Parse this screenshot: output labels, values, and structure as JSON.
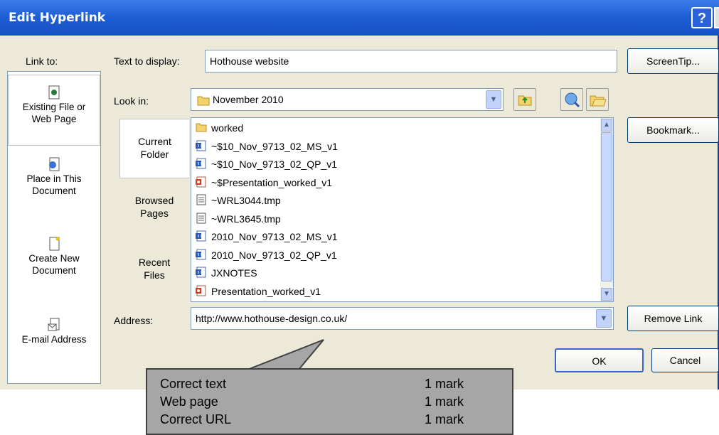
{
  "window": {
    "title": "Edit Hyperlink",
    "help_label": "?"
  },
  "link_to": {
    "label": "Link to:",
    "items": [
      {
        "label_line1": "Existing File or",
        "label_line2": "Web Page"
      },
      {
        "label_line1": "Place in This",
        "label_line2": "Document"
      },
      {
        "label_line1": "Create New",
        "label_line2": "Document"
      },
      {
        "label_line1": "E-mail Address",
        "label_line2": ""
      }
    ]
  },
  "text_to_display": {
    "label": "Text to display:",
    "value": "Hothouse website"
  },
  "screentip_button": "ScreenTip...",
  "look_in": {
    "label": "Look in:",
    "value": "November 2010"
  },
  "tabs": [
    {
      "line1": "Current",
      "line2": "Folder"
    },
    {
      "line1": "Browsed",
      "line2": "Pages"
    },
    {
      "line1": "Recent",
      "line2": "Files"
    }
  ],
  "files": [
    {
      "name": "worked",
      "icon": "folder-icon"
    },
    {
      "name": "~$10_Nov_9713_02_MS_v1",
      "icon": "word-doc-icon"
    },
    {
      "name": "~$10_Nov_9713_02_QP_v1",
      "icon": "word-doc-icon"
    },
    {
      "name": "~$Presentation_worked_v1",
      "icon": "powerpoint-icon"
    },
    {
      "name": "~WRL3044.tmp",
      "icon": "tmp-file-icon"
    },
    {
      "name": "~WRL3645.tmp",
      "icon": "tmp-file-icon"
    },
    {
      "name": "2010_Nov_9713_02_MS_v1",
      "icon": "word-doc-icon"
    },
    {
      "name": "2010_Nov_9713_02_QP_v1",
      "icon": "word-doc-icon"
    },
    {
      "name": "JXNOTES",
      "icon": "word-doc-icon"
    },
    {
      "name": "Presentation_worked_v1",
      "icon": "powerpoint-icon"
    }
  ],
  "bookmark_button": "Bookmark...",
  "address": {
    "label": "Address:",
    "value": "http://www.hothouse-design.co.uk/"
  },
  "remove_link_button": "Remove Link",
  "ok_button": "OK",
  "cancel_button": "Cancel",
  "callout": {
    "rows": [
      {
        "item": "Correct text",
        "marks": "1 mark"
      },
      {
        "item": "Web page",
        "marks": "1 mark"
      },
      {
        "item": "Correct URL",
        "marks": "1 mark"
      }
    ]
  },
  "colors": {
    "titlebar": "#1f5fd6",
    "dialog_bg": "#ece9d8",
    "callout_bg": "#a6a6a6"
  }
}
